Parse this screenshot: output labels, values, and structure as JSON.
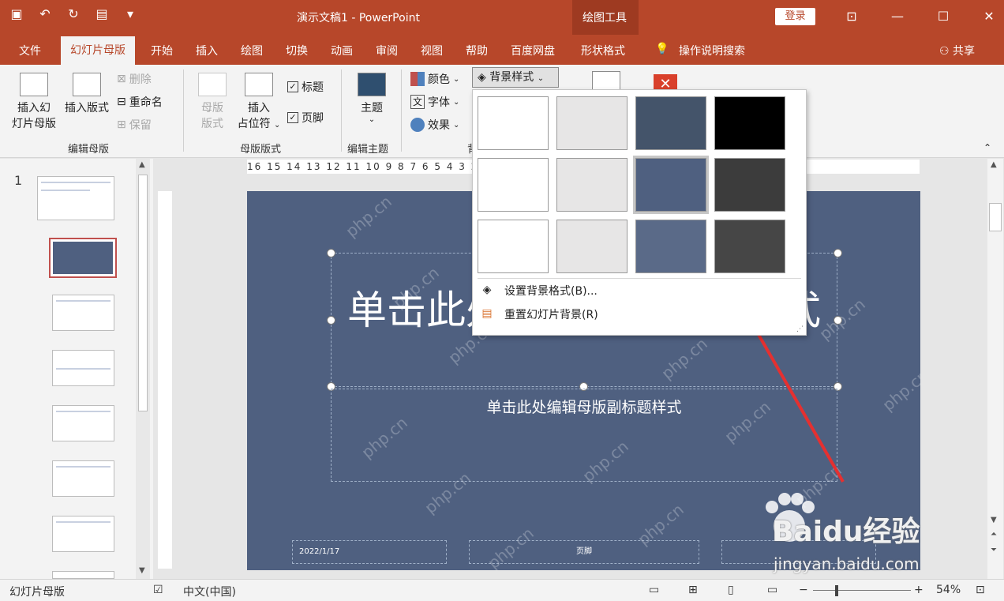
{
  "titlebar": {
    "doc_title": "演示文稿1 - PowerPoint",
    "context_tools": "绘图工具",
    "login": "登录"
  },
  "tabs": [
    {
      "label": "文件"
    },
    {
      "label": "幻灯片母版"
    },
    {
      "label": "开始"
    },
    {
      "label": "插入"
    },
    {
      "label": "绘图"
    },
    {
      "label": "切换"
    },
    {
      "label": "动画"
    },
    {
      "label": "审阅"
    },
    {
      "label": "视图"
    },
    {
      "label": "帮助"
    },
    {
      "label": "百度网盘"
    },
    {
      "label": "形状格式"
    },
    {
      "label": "操作说明搜索"
    }
  ],
  "share": "共享",
  "ribbon": {
    "insert_master_1": "插入幻",
    "insert_master_2": "灯片母版",
    "insert_layout": "插入版式",
    "delete": "删除",
    "rename": "重命名",
    "preserve": "保留",
    "group_edit_master": "编辑母版",
    "master_layout_1": "母版",
    "master_layout_2": "版式",
    "insert_placeholder_1": "插入",
    "insert_placeholder_2": "占位符",
    "title_chk": "标题",
    "footer_chk": "页脚",
    "group_master_layout": "母版版式",
    "theme": "主题",
    "group_edit_theme": "编辑主题",
    "colors": "颜色",
    "fonts": "字体",
    "effects": "效果",
    "bg_styles": "背景样式",
    "group_bg_partial": "背"
  },
  "dropdown": {
    "format_bg": "设置背景格式(B)...",
    "reset_bg": "重置幻灯片背景(R)",
    "swatch_colors": [
      "#ffffff",
      "#e7e6e6",
      "#44546a",
      "#000000",
      "#ffffff",
      "#e7e6e6",
      "#4f6080",
      "#3c3c3c",
      "#ffffff",
      "#e7e6e6",
      "#5a6a88",
      "#464646"
    ]
  },
  "ruler_h_text": "16 15 14 13 12 11 10 9 8 7 6 5 4 3 2 1 0 1 2 3 4 5 6 7 8 9 10 11 12 13 14 15 16",
  "slide": {
    "title_text": "单击此处编辑母版标题样式",
    "subtitle_text": "单击此处编辑母版副标题样式",
    "date": "2022/1/17",
    "footer": "页脚",
    "bg_color": "#4f6080"
  },
  "panel": {
    "slide_number": "1"
  },
  "status": {
    "view": "幻灯片母版",
    "language": "中文(中国)",
    "zoom": "54%"
  },
  "watermark": {
    "site": "php.cn",
    "baidu_text": "Baidu经验",
    "baidu_url": "jingyan.baidu.com"
  }
}
